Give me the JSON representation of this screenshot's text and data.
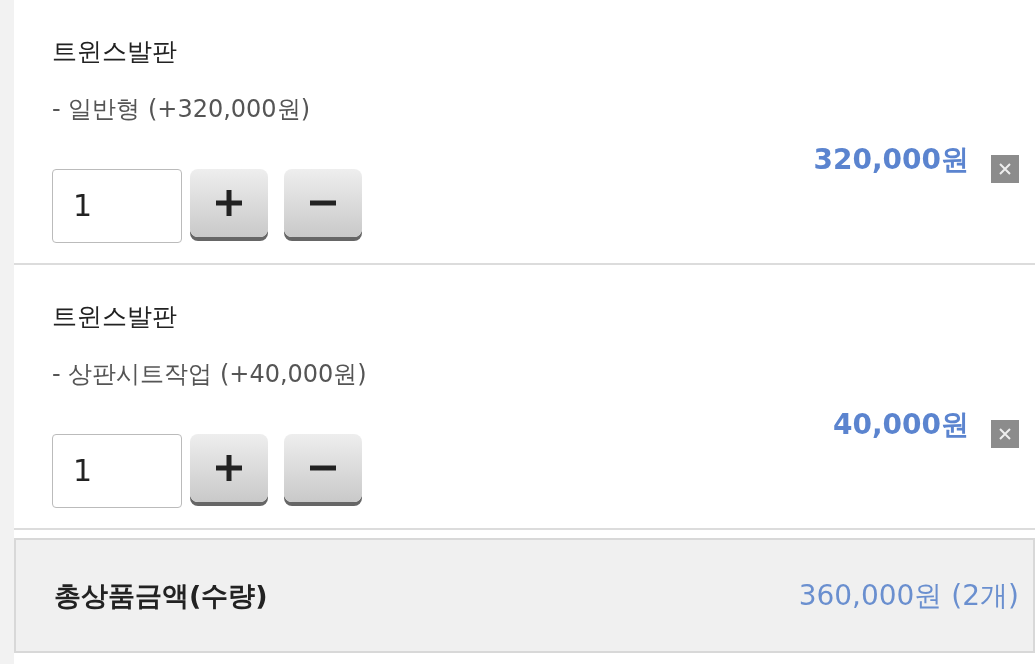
{
  "items": [
    {
      "title": "트윈스발판",
      "option": "- 일반형 (+320,000원)",
      "quantity": "1",
      "price": "320,000원"
    },
    {
      "title": "트윈스발판",
      "option": "- 상판시트작업 (+40,000원)",
      "quantity": "1",
      "price": "40,000원"
    }
  ],
  "total": {
    "label": "총상품금액(수량)",
    "value": "360,000원 (2개)"
  }
}
